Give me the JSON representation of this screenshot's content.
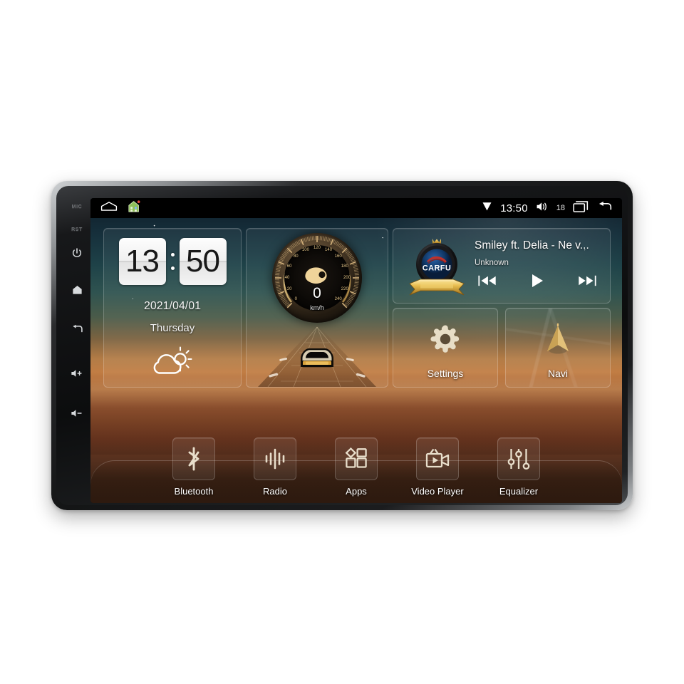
{
  "device": {
    "bezel_buttons": [
      {
        "name": "mic",
        "label": "MIC",
        "type": "text"
      },
      {
        "name": "reset",
        "label": "RST",
        "type": "text"
      },
      {
        "name": "power",
        "label": "",
        "type": "icon"
      },
      {
        "name": "home",
        "label": "",
        "type": "icon"
      },
      {
        "name": "back",
        "label": "",
        "type": "icon"
      },
      {
        "name": "volume-up",
        "label": "",
        "type": "icon"
      },
      {
        "name": "volume-down",
        "label": "",
        "type": "icon"
      }
    ]
  },
  "status_bar": {
    "left_icons": [
      "home-outline-icon",
      "home-green-icon"
    ],
    "signal_icon": "signal-icon",
    "time": "13:50",
    "volume_icon": "volume-icon",
    "volume_level": "18",
    "recents_icon": "recents-icon",
    "back_icon": "back-icon"
  },
  "clock_widget": {
    "hours": "13",
    "minutes": "50",
    "date": "2021/04/01",
    "weekday": "Thursday",
    "weather_icon": "partly-cloudy-icon"
  },
  "speedometer": {
    "value": "0",
    "unit": "km/h",
    "tick_labels": [
      "0",
      "20",
      "40",
      "60",
      "80",
      "100",
      "120",
      "140",
      "160",
      "180",
      "200",
      "220",
      "240"
    ],
    "min": 0,
    "max": 240,
    "pointer_icon": "gauge-needle-icon",
    "car_icon": "car-on-road-icon"
  },
  "music_player": {
    "album_art": "carfu-badge-logo",
    "brand_text": "CARFU",
    "title": "Smiley ft. Delia - Ne v...",
    "artist": "Unknown",
    "controls": [
      {
        "name": "previous-track",
        "icon": "skip-previous-icon"
      },
      {
        "name": "play",
        "icon": "play-icon"
      },
      {
        "name": "next-track",
        "icon": "skip-next-icon"
      }
    ]
  },
  "tiles": [
    {
      "name": "settings",
      "label": "Settings",
      "icon": "gear-icon"
    },
    {
      "name": "navi",
      "label": "Navi",
      "icon": "navigation-arrow-icon"
    }
  ],
  "dock": [
    {
      "name": "bluetooth",
      "label": "Bluetooth",
      "icon": "bluetooth-icon"
    },
    {
      "name": "radio",
      "label": "Radio",
      "icon": "radio-waveform-icon"
    },
    {
      "name": "apps",
      "label": "Apps",
      "icon": "apps-grid-icon"
    },
    {
      "name": "video-player",
      "label": "Video Player",
      "icon": "camcorder-icon"
    },
    {
      "name": "equalizer",
      "label": "Equalizer",
      "icon": "equalizer-sliders-icon"
    }
  ],
  "colors": {
    "accent_gold": "#e4c48a",
    "screen_text": "#ffffff",
    "status_bar_bg": "#000000"
  }
}
